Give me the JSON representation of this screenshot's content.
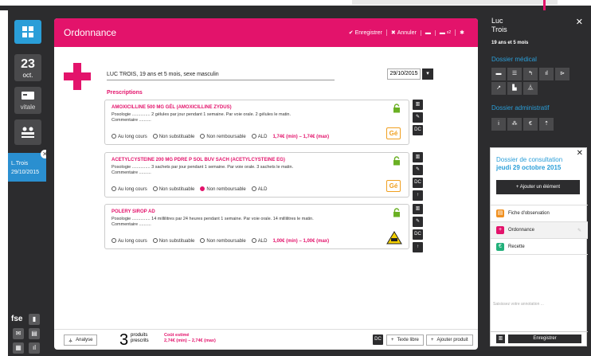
{
  "sidebar": {
    "date_day": "23",
    "date_month": "oct.",
    "vitale": "vitale",
    "patient_tab": "L.Trois",
    "patient_tab_date": "29/10/2015",
    "fse": "fse"
  },
  "header": {
    "title": "Ordonnance",
    "save": "Enregistrer",
    "cancel": "Annuler",
    "print_badge": "x2"
  },
  "patient": {
    "line": "LUC TROIS, 19 ans et 5 mois, sexe masculin",
    "date": "29/10/2015"
  },
  "prescriptions": {
    "title": "Prescriptions",
    "items": [
      {
        "name": "AMOXICILLINE 500 mg gél (AMOXICILLINE ZYDUS)",
        "posologie": "Posologie ............... 2 gélules par jour pendant 1 semaine. Par voie orale. 2 gélules le matin.",
        "commentaire": "Commentaire ..........",
        "options": [
          "Au long cours",
          "Non substituable",
          "Non remboursable",
          "ALD"
        ],
        "selected": -1,
        "cost": "1,74€ (min) – 1,74€ (max)",
        "badge": "Gé"
      },
      {
        "name": "ACETYLCYSTEINE 200 mg pdre p sol buv sach (ACETYLCYSTEINE EG)",
        "posologie": "Posologie ............... 3 sachets par jour pendant 1 semaine. Par voie orale. 3 sachets le matin.",
        "commentaire": "Commentaire ..........",
        "options": [
          "Au long cours",
          "Non substituable",
          "Non remboursable",
          "ALD"
        ],
        "selected": 2,
        "cost": "",
        "badge": "Gé"
      },
      {
        "name": "POLERY sirop ad",
        "posologie": "Posologie ............... 14 millilitres par 24 heures pendant 1 semaine. Par voie orale. 14 millilitres le matin.",
        "commentaire": "Commentaire ..........",
        "options": [
          "Au long cours",
          "Non substituable",
          "Non remboursable",
          "ALD"
        ],
        "selected": -1,
        "cost": "1,00€ (min) – 1,00€ (max)",
        "badge": ""
      }
    ],
    "dc": "DC"
  },
  "footer": {
    "analyse": "Analyse",
    "count": "3",
    "count_l1": "produits",
    "count_l2": "prescrits",
    "cost_title": "Coût estimé",
    "cost": "2,74€ (min) – 2,74€ (max)",
    "dc": "DC",
    "texte": "Texte libre",
    "ajouter": "Ajouter produit"
  },
  "right": {
    "first": "Luc",
    "last": "Trois",
    "age": "19 ans et 5 mois",
    "medical": "Dossier médical",
    "admin": "Dossier administratif"
  },
  "consult": {
    "title": "Dossier de consultation",
    "date": "jeudi 29 octobre 2015",
    "add": "Ajouter un élément",
    "items": [
      "Fiche d'observation",
      "Ordonnance",
      "Recette"
    ],
    "note": "Saisissez votre annotation ...",
    "save": "Enregistrer"
  },
  "colors": {
    "accent": "#e3136b",
    "blue": "#2a9ed8",
    "dark": "#2c2c2e"
  }
}
